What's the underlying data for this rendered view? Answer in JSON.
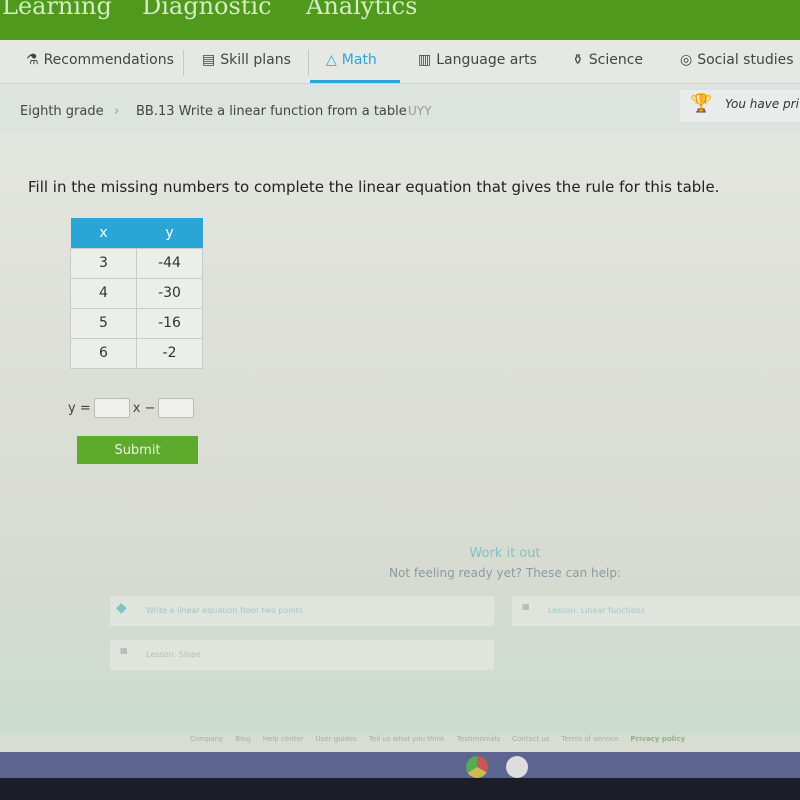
{
  "top_nav": [
    "Learning",
    "Diagnostic",
    "Analytics"
  ],
  "subnav": [
    {
      "label": "Recommendations",
      "icon": "microscope-icon"
    },
    {
      "label": "Skill plans",
      "icon": "clipboard-icon"
    },
    {
      "label": "Math",
      "icon": "pyramid-icon",
      "active": true
    },
    {
      "label": "Language arts",
      "icon": "book-icon"
    },
    {
      "label": "Science",
      "icon": "flask-icon"
    },
    {
      "label": "Social studies",
      "icon": "globe-icon"
    }
  ],
  "breadcrumb": {
    "grade": "Eighth grade",
    "skill": "BB.13 Write a linear function from a table",
    "code": "UYY"
  },
  "prize": "You have pri",
  "question": "Fill in the missing numbers to complete the linear equation that gives the rule for this table.",
  "table": {
    "headers": [
      "x",
      "y"
    ],
    "rows": [
      [
        "3",
        "-44"
      ],
      [
        "4",
        "-30"
      ],
      [
        "5",
        "-16"
      ],
      [
        "6",
        "-2"
      ]
    ]
  },
  "equation": {
    "lhs": "y =",
    "mid": "x −",
    "slope_value": "",
    "intercept_value": ""
  },
  "submit": "Submit",
  "help": {
    "title": "Work it out",
    "subtitle": "Not feeling ready yet? These can help:",
    "items": [
      "Write a linear equation from two points",
      "Lesson: Linear functions",
      "Lesson: Slope"
    ]
  },
  "footer": [
    "Company",
    "Blog",
    "Help center",
    "User guides",
    "Tell us what you think",
    "Testimonials",
    "Contact us",
    "Terms of service",
    "Privacy policy"
  ],
  "colors": {
    "brand_green": "#4f9a1c",
    "accent_blue": "#2aa6d6",
    "submit_green": "#5daa2c"
  }
}
